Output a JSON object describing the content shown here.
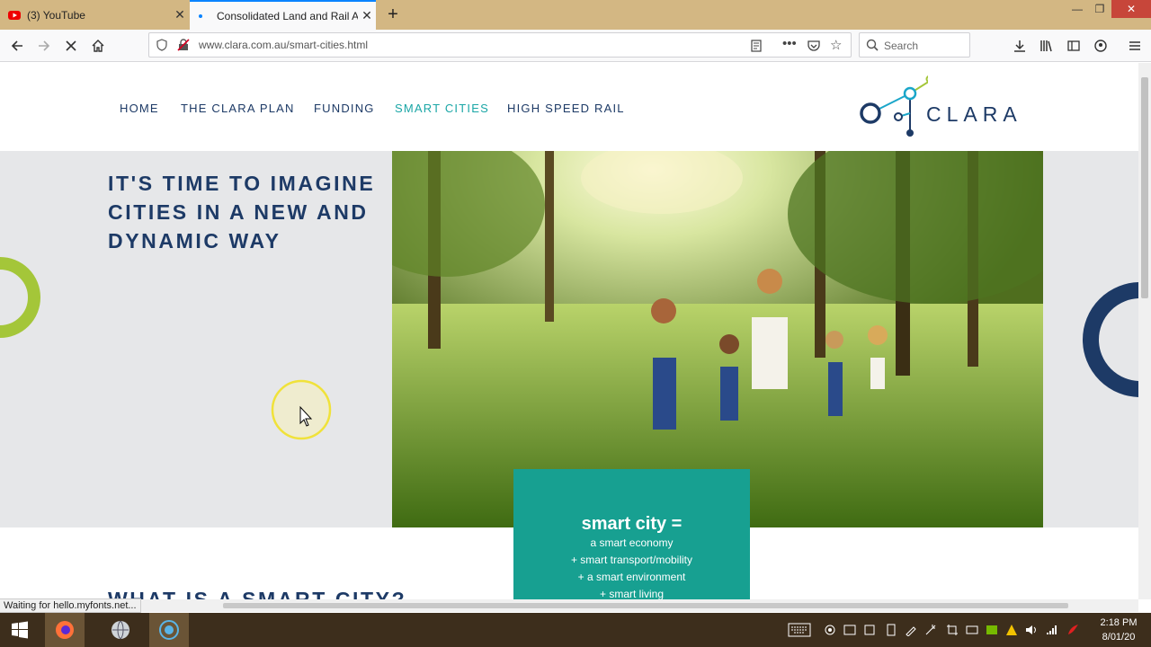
{
  "browser": {
    "tabs": [
      {
        "title": "(3) YouTube",
        "active": false
      },
      {
        "title": "Consolidated Land and Rail Au",
        "active": true
      }
    ],
    "url": "www.clara.com.au/smart-cities.html",
    "search_placeholder": "Search",
    "status_text": "Waiting for hello.myfonts.net..."
  },
  "site": {
    "menu": [
      "HOME",
      "THE CLARA PLAN",
      "FUNDING",
      "SMART CITIES",
      "HIGH SPEED RAIL"
    ],
    "active_menu": "SMART CITIES",
    "logo_text": "CLARA",
    "hero_heading": "IT'S TIME TO IMAGINE CITIES IN A NEW AND DYNAMIC WAY",
    "smart_box": {
      "title": "smart city =",
      "lines": [
        "a smart economy",
        "+ smart transport/mobility",
        "+ a smart environment",
        "+ smart living"
      ]
    },
    "section_heading": "WHAT IS A SMART CITY?"
  },
  "taskbar": {
    "time": "2:18 PM",
    "date": "8/01/20"
  },
  "colors": {
    "navy": "#1d3a66",
    "teal": "#17a091",
    "lime": "#a4c639",
    "titlebar": "#d3b783",
    "taskbar": "#3d2e1c"
  }
}
